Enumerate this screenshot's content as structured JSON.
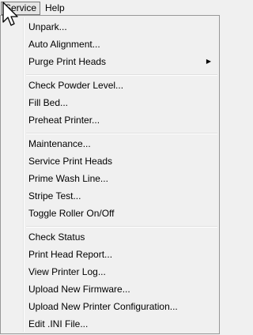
{
  "menubar": {
    "items": [
      {
        "label": "Service"
      },
      {
        "label": "Help"
      }
    ]
  },
  "menu": {
    "groups": [
      {
        "items": [
          {
            "label": "Unpark..."
          },
          {
            "label": "Auto Alignment..."
          },
          {
            "label": "Purge Print Heads",
            "submenu_icon": "chevron-right-icon"
          }
        ]
      },
      {
        "items": [
          {
            "label": "Check Powder Level..."
          },
          {
            "label": "Fill Bed..."
          },
          {
            "label": "Preheat Printer..."
          }
        ]
      },
      {
        "items": [
          {
            "label": "Maintenance..."
          },
          {
            "label": "Service Print Heads"
          },
          {
            "label": "Prime Wash Line..."
          },
          {
            "label": "Stripe Test..."
          },
          {
            "label": "Toggle Roller On/Off"
          }
        ]
      },
      {
        "items": [
          {
            "label": "Check Status"
          },
          {
            "label": "Print Head Report..."
          },
          {
            "label": "View Printer Log..."
          },
          {
            "label": "Upload New Firmware..."
          },
          {
            "label": "Upload New Printer Configuration..."
          },
          {
            "label": "Edit .INI File..."
          }
        ]
      }
    ]
  },
  "cursor": {
    "icon": "mouse-pointer-icon"
  }
}
